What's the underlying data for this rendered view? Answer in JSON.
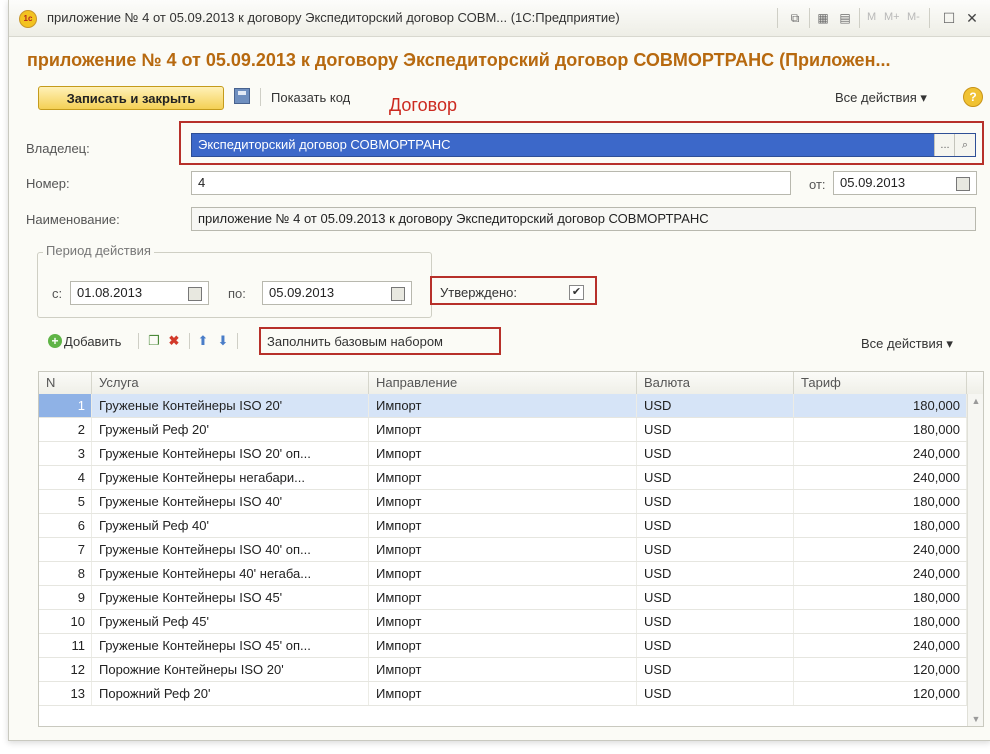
{
  "window": {
    "title": "приложение № 4 от 05.09.2013 к договору Экспедиторский договор СОВМ... (1С:Предприятие)",
    "app_logo": "1с",
    "tb_m": "M",
    "tb_mplus": "M+",
    "tb_mminus": "M-"
  },
  "header": {
    "title": "приложение № 4 от 05.09.2013 к договору Экспедиторский договор СОВМОРТРАНС (Приложен..."
  },
  "toolbar": {
    "save_close": "Записать и закрыть",
    "show_code": "Показать код",
    "all_actions": "Все действия ▾",
    "help": "?"
  },
  "annotation": {
    "dogovor": "Договор"
  },
  "form": {
    "owner_label": "Владелец:",
    "owner_value": "Экспедиторский договор СОВМОРТРАНС",
    "owner_dots": "...",
    "owner_search": "⌕",
    "number_label": "Номер:",
    "number_value": "4",
    "from_label": "от:",
    "date_value": "05.09.2013",
    "name_label": "Наименование:",
    "name_value": "приложение № 4 от 05.09.2013 к договору Экспедиторский договор СОВМОРТРАНС"
  },
  "period": {
    "title": "Период действия",
    "from_label": "с:",
    "from_value": "01.08.2013",
    "to_label": "по:",
    "to_value": "05.09.2013"
  },
  "approved": {
    "label": "Утверждено:",
    "checked": "✔"
  },
  "table_toolbar": {
    "add": "Добавить",
    "fill": "Заполнить базовым набором",
    "all_actions": "Все действия ▾"
  },
  "table": {
    "headers": [
      "N",
      "Услуга",
      "Направление",
      "Валюта",
      "Тариф"
    ],
    "rows": [
      {
        "n": "1",
        "service": "Груженые Контейнеры ISO 20'",
        "direction": "Импорт",
        "currency": "USD",
        "tariff": "180,000"
      },
      {
        "n": "2",
        "service": "Груженый Реф 20'",
        "direction": "Импорт",
        "currency": "USD",
        "tariff": "180,000"
      },
      {
        "n": "3",
        "service": "Груженые Контейнеры ISO 20' оп...",
        "direction": "Импорт",
        "currency": "USD",
        "tariff": "240,000"
      },
      {
        "n": "4",
        "service": "Груженые Контейнеры негабари...",
        "direction": "Импорт",
        "currency": "USD",
        "tariff": "240,000"
      },
      {
        "n": "5",
        "service": "Груженые Контейнеры ISO 40'",
        "direction": "Импорт",
        "currency": "USD",
        "tariff": "180,000"
      },
      {
        "n": "6",
        "service": "Груженый Реф 40'",
        "direction": "Импорт",
        "currency": "USD",
        "tariff": "180,000"
      },
      {
        "n": "7",
        "service": "Груженые Контейнеры ISO 40' оп...",
        "direction": "Импорт",
        "currency": "USD",
        "tariff": "240,000"
      },
      {
        "n": "8",
        "service": "Груженые Контейнеры 40' негаба...",
        "direction": "Импорт",
        "currency": "USD",
        "tariff": "240,000"
      },
      {
        "n": "9",
        "service": "Груженые Контейнеры ISO 45'",
        "direction": "Импорт",
        "currency": "USD",
        "tariff": "180,000"
      },
      {
        "n": "10",
        "service": "Груженый Реф 45'",
        "direction": "Импорт",
        "currency": "USD",
        "tariff": "180,000"
      },
      {
        "n": "11",
        "service": "Груженые Контейнеры ISO 45' оп...",
        "direction": "Импорт",
        "currency": "USD",
        "tariff": "240,000"
      },
      {
        "n": "12",
        "service": "Порожние Контейнеры ISO 20'",
        "direction": "Импорт",
        "currency": "USD",
        "tariff": "120,000"
      },
      {
        "n": "13",
        "service": "Порожний Реф 20'",
        "direction": "Импорт",
        "currency": "USD",
        "tariff": "120,000"
      }
    ]
  },
  "colors": {
    "accent_title": "#b7690f",
    "annotation_red": "#cc2a20",
    "selection_blue": "#3c68c9"
  }
}
